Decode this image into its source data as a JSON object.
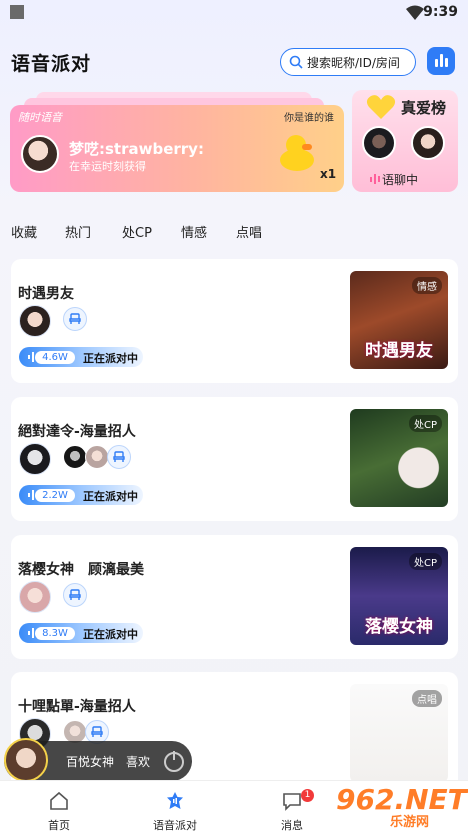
{
  "status_bar": {
    "time": "9:39"
  },
  "header": {
    "title": "语音派对",
    "search_placeholder": "搜索昵称/ID/房间"
  },
  "banner": {
    "tag": "随时语音",
    "hint": "你是谁的谁",
    "name": "梦呓:strawberry:",
    "subtitle": "在幸运时刻获得",
    "gift_count": "x1"
  },
  "love_list": {
    "title": "真爱榜",
    "status": "语聊中"
  },
  "categories": [
    "收藏",
    "热门",
    "处CP",
    "情感",
    "点唱"
  ],
  "rooms": [
    {
      "title": "时遇男友",
      "count": "4.6W",
      "status": "正在派对中",
      "cover_tag": "情感",
      "cover_title": "时遇男友",
      "members": 0
    },
    {
      "title": "絕對達令-海量招人",
      "count": "2.2W",
      "status": "正在派对中",
      "cover_tag": "处CP",
      "cover_title": "",
      "members": 2
    },
    {
      "title": "落樱女神　顾漓最美",
      "count": "8.3W",
      "status": "正在派对中",
      "cover_tag": "处CP",
      "cover_title": "落樱女神",
      "members": 0
    },
    {
      "title": "十哩點單-海量招人",
      "count": "",
      "status": "",
      "cover_tag": "点唱",
      "cover_title": "",
      "members": 1
    }
  ],
  "mini_player": {
    "text": "百悦女神　喜欢"
  },
  "tabbar": {
    "tabs": [
      {
        "label": "首页"
      },
      {
        "label": "语音派对"
      },
      {
        "label": "消息",
        "badge": "1"
      }
    ]
  },
  "watermark": {
    "main": "962.NET",
    "sub": "乐游网"
  },
  "colors": {
    "accent": "#2f7cf6",
    "badge": "#f23a3a",
    "pink": "#ff9bc7"
  }
}
